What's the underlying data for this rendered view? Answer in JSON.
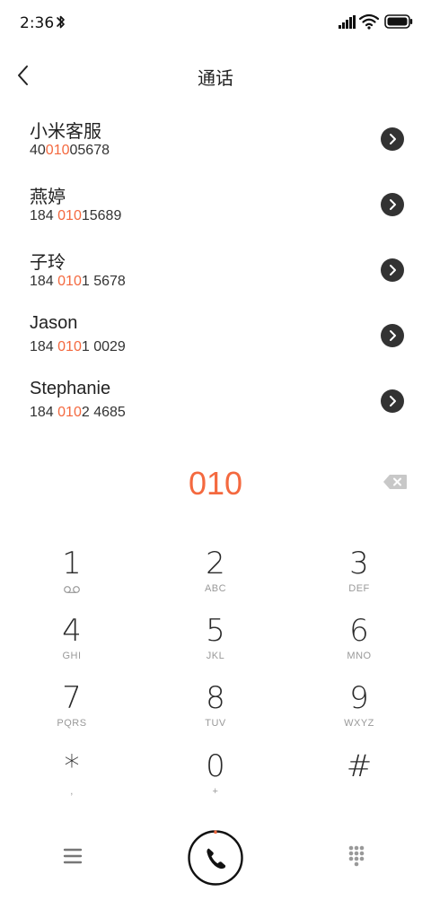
{
  "status_bar": {
    "time": "2:36",
    "icons": [
      "bluetooth-icon",
      "signal-icon",
      "wifi-icon",
      "battery-icon"
    ]
  },
  "header": {
    "title": "通话",
    "back_icon": "chevron-left-icon"
  },
  "contacts": [
    {
      "name": "小米客服",
      "number_parts": [
        "40",
        "010",
        "05678"
      ]
    },
    {
      "name": "燕婷",
      "number_parts": [
        "184 ",
        "010",
        "15689"
      ]
    },
    {
      "name": "子玲",
      "number_parts": [
        "184 ",
        "010",
        "1 5678"
      ]
    },
    {
      "name": "Jason",
      "number_parts": [
        "184 ",
        "010",
        "1 0029"
      ]
    },
    {
      "name": "Stephanie",
      "number_parts": [
        "184 ",
        "010",
        "2 4685"
      ]
    }
  ],
  "dialer": {
    "input": "010",
    "backspace_icon": "backspace-icon"
  },
  "keypad": [
    {
      "digit": "1",
      "letters": "",
      "sub_icon": "voicemail-icon"
    },
    {
      "digit": "2",
      "letters": "ABC"
    },
    {
      "digit": "3",
      "letters": "DEF"
    },
    {
      "digit": "4",
      "letters": "GHI"
    },
    {
      "digit": "5",
      "letters": "JKL"
    },
    {
      "digit": "6",
      "letters": "MNO"
    },
    {
      "digit": "7",
      "letters": "PQRS"
    },
    {
      "digit": "8",
      "letters": "TUV"
    },
    {
      "digit": "9",
      "letters": "WXYZ"
    },
    {
      "digit": "*",
      "letters": ","
    },
    {
      "digit": "0",
      "letters": "+"
    },
    {
      "digit": "#",
      "letters": ""
    }
  ],
  "bottom_bar": {
    "icons": [
      "menu-icon",
      "phone-icon",
      "dialpad-icon"
    ]
  },
  "colors": {
    "accent": "#f4693f",
    "text": "#222222",
    "secondary_text": "#999999",
    "detail_button": "#333333"
  }
}
